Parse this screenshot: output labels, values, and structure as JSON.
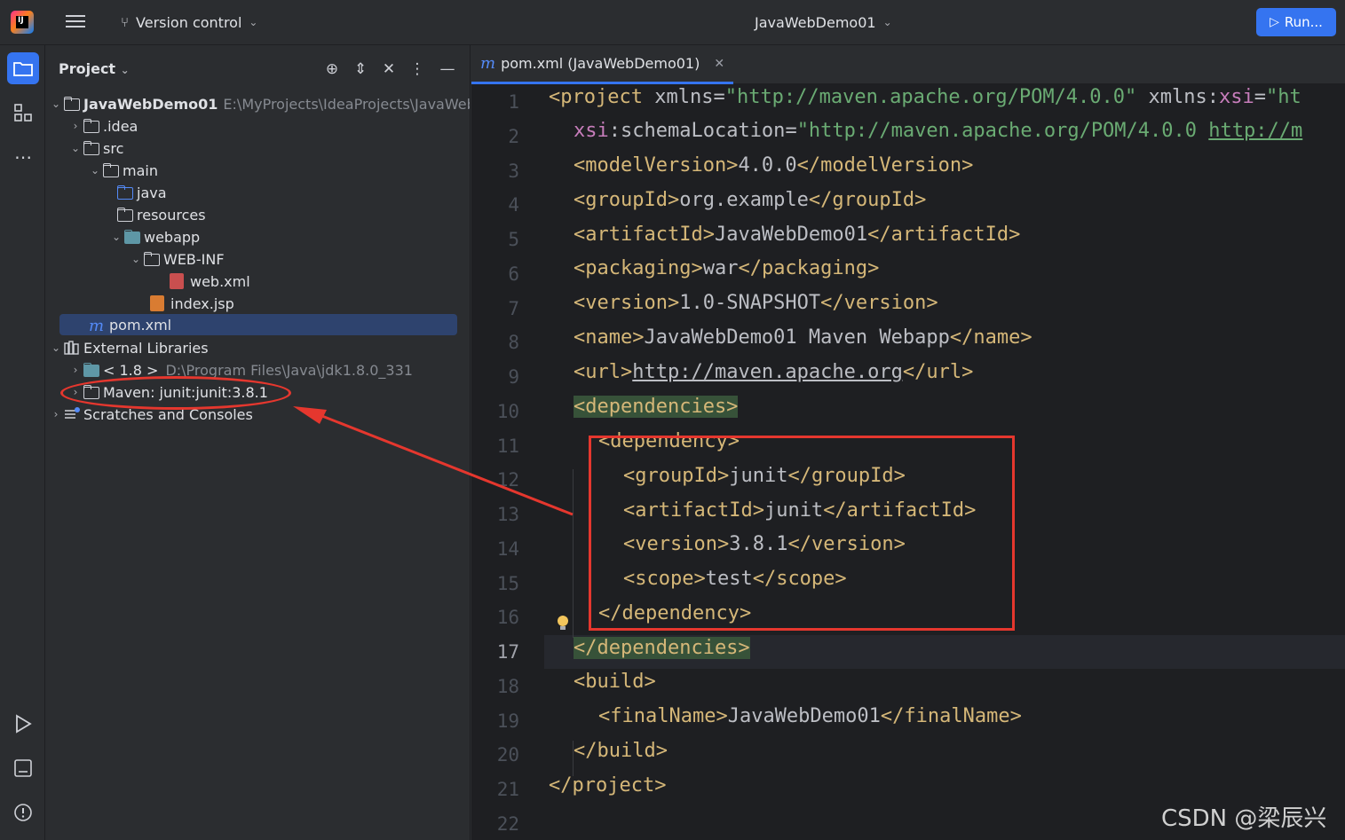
{
  "titlebar": {
    "version_control": "Version control",
    "project_name": "JavaWebDemo01",
    "run_label": "Run..."
  },
  "panel": {
    "title": "Project"
  },
  "tree": [
    {
      "label": "JavaWebDemo01",
      "detail": "E:\\MyProjects\\IdeaProjects\\JavaWeb",
      "icon": "module-folder-icon",
      "expanded": true
    },
    {
      "label": ".idea",
      "icon": "folder-icon",
      "expanded": false
    },
    {
      "label": "src",
      "icon": "folder-icon",
      "expanded": true
    },
    {
      "label": "main",
      "icon": "folder-icon",
      "expanded": true
    },
    {
      "label": "java",
      "icon": "source-folder-icon"
    },
    {
      "label": "resources",
      "icon": "resources-folder-icon"
    },
    {
      "label": "webapp",
      "icon": "web-folder-icon",
      "expanded": true
    },
    {
      "label": "WEB-INF",
      "icon": "folder-icon",
      "expanded": true
    },
    {
      "label": "web.xml",
      "icon": "xml-file-icon"
    },
    {
      "label": "index.jsp",
      "icon": "jsp-file-icon"
    },
    {
      "label": "pom.xml",
      "icon": "maven-file-icon",
      "selected": true
    },
    {
      "label": "External Libraries",
      "icon": "libraries-icon",
      "expanded": true
    },
    {
      "label": "< 1.8 >",
      "detail": "D:\\Program Files\\Java\\jdk1.8.0_331",
      "icon": "jdk-icon",
      "expanded": false
    },
    {
      "label": "Maven: junit:junit:3.8.1",
      "icon": "library-folder-icon",
      "expanded": false
    },
    {
      "label": "Scratches and Consoles",
      "icon": "scratches-icon",
      "expanded": false
    }
  ],
  "editor": {
    "tab_label": "pom.xml (JavaWebDemo01)",
    "tab_icon_letter": "m",
    "current_line": 17,
    "line_numbers": [
      "1",
      "2",
      "3",
      "4",
      "5",
      "6",
      "7",
      "8",
      "9",
      "10",
      "11",
      "12",
      "13",
      "14",
      "15",
      "16",
      "17",
      "18",
      "19",
      "20",
      "21",
      "22"
    ]
  },
  "code": {
    "l1_tag_open": "<project ",
    "l1_attr1": "xmlns",
    "l1_eq1": "=",
    "l1_val1": "\"http://maven.apache.org/POM/4.0.0\"",
    "l1_sp": " ",
    "l1_attr2a": "xmlns",
    "l1_attr2b": ":",
    "l1_attr2c": "xsi",
    "l1_eq2": "=",
    "l1_val2": "\"ht",
    "l2_ns": "xsi",
    "l2_attr": ":schemaLocation",
    "l2_eq": "=",
    "l2_val": "\"http://maven.apache.org/POM/4.0.0 ",
    "l2_url": "http://m",
    "l3_open": "<modelVersion>",
    "l3_text": "4.0.0",
    "l3_close": "</modelVersion>",
    "l4_open": "<groupId>",
    "l4_text": "org.example",
    "l4_close": "</groupId>",
    "l5_open": "<artifactId>",
    "l5_text": "JavaWebDemo01",
    "l5_close": "</artifactId>",
    "l6_open": "<packaging>",
    "l6_text": "war",
    "l6_close": "</packaging>",
    "l7_open": "<version>",
    "l7_text": "1.0-SNAPSHOT",
    "l7_close": "</version>",
    "l8_open": "<name>",
    "l8_text": "JavaWebDemo01 Maven Webapp",
    "l8_close": "</name>",
    "l9_open": "<url>",
    "l9_text": "http://maven.apache.org",
    "l9_close": "</url>",
    "l10": "<dependencies>",
    "l11": "<dependency>",
    "l12_open": "<groupId>",
    "l12_text": "junit",
    "l12_close": "</groupId>",
    "l13_open": "<artifactId>",
    "l13_text": "junit",
    "l13_close": "</artifactId>",
    "l14_open": "<version>",
    "l14_text": "3.8.1",
    "l14_close": "</version>",
    "l15_open": "<scope>",
    "l15_text": "test",
    "l15_close": "</scope>",
    "l16": "</dependency>",
    "l17": "</dependencies>",
    "l18": "<build>",
    "l19_open": "<finalName>",
    "l19_text": "JavaWebDemo01",
    "l19_close": "</finalName>",
    "l20": "</build>",
    "l21": "</project>"
  },
  "colors": {
    "accent": "#3574f0",
    "annotation_red": "#e5372e",
    "xml_tag": "#d5b778",
    "xml_string": "#6aab73"
  },
  "watermark": "CSDN @梁辰兴"
}
